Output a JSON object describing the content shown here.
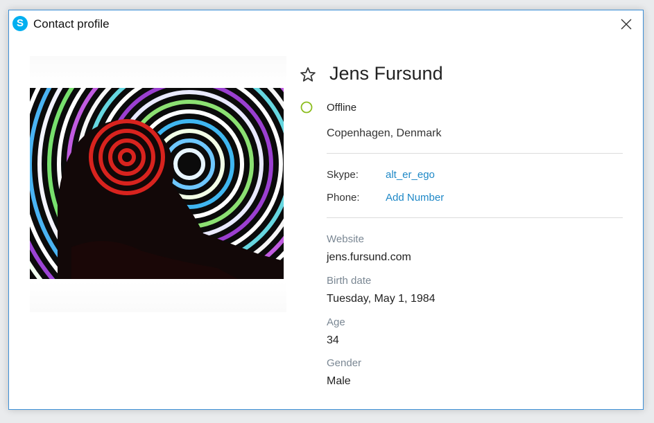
{
  "window": {
    "title": "Contact profile",
    "logo_letter": "S",
    "accent_color": "#00aff0"
  },
  "contact": {
    "name": "Jens Fursund",
    "status": "Offline",
    "status_color": "#8cbd1f",
    "location": "Copenhagen, Denmark"
  },
  "accounts": {
    "skype_label": "Skype:",
    "skype_value": "alt_er_ego",
    "phone_label": "Phone:",
    "phone_value": "Add Number",
    "link_color": "#1e88c7"
  },
  "details": {
    "website_label": "Website",
    "website_value": "jens.fursund.com",
    "birthdate_label": "Birth date",
    "birthdate_value": "Tuesday, May 1, 1984",
    "age_label": "Age",
    "age_value": "34",
    "gender_label": "Gender",
    "gender_value": "Male"
  },
  "icons": {
    "logo": "skype-logo-icon",
    "close": "close-icon",
    "favorite": "star-outline-icon",
    "status": "status-ring-icon"
  }
}
